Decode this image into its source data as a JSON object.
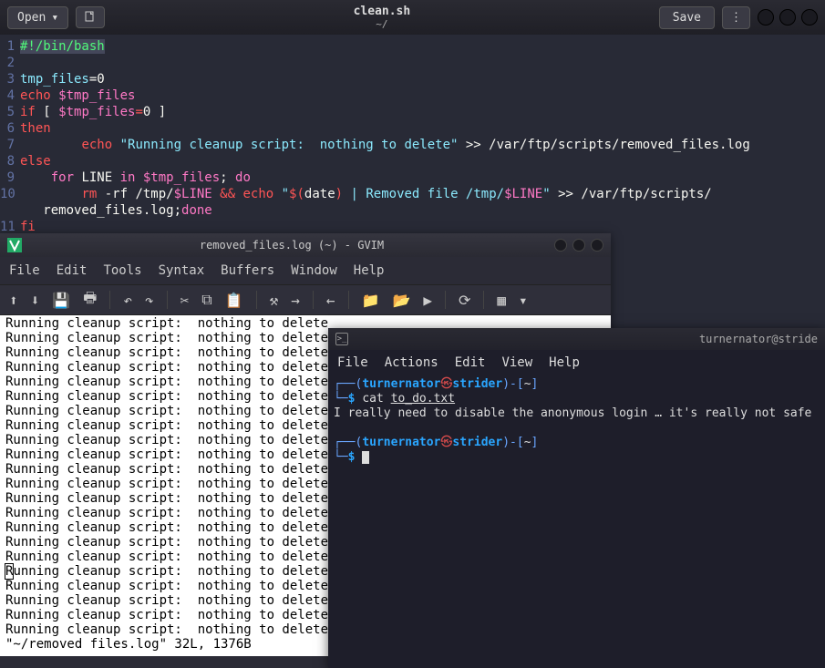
{
  "gedit": {
    "open_label": "Open",
    "title": "clean.sh",
    "subtitle": "~/",
    "save_label": "Save",
    "code": {
      "l1": {
        "a": "#!/bin/bash"
      },
      "l3": {
        "a": "tmp_files",
        "b": "=0"
      },
      "l4": {
        "a": "echo",
        "b": " $tmp_files"
      },
      "l5": {
        "a": "if",
        "b": " [ ",
        "c": "$tmp_files",
        "d": "=",
        "e": "0",
        "f": " ]"
      },
      "l6": {
        "a": "then"
      },
      "l7": {
        "a": "        ",
        "b": "echo",
        "c": " \"Running cleanup script:  nothing to delete\"",
        "d": " >> ",
        "e": "/var/ftp/scripts/removed_files.log"
      },
      "l8": {
        "a": "else"
      },
      "l9": {
        "a": "    ",
        "b": "for",
        "c": " LINE ",
        "d": "in",
        "e": " $tmp_files",
        "f": "; ",
        "g": "do"
      },
      "l10": {
        "a": "        ",
        "b": "rm",
        "c": " -rf /tmp/",
        "d": "$LINE",
        "e": " && ",
        "f": "echo",
        "g": " \"",
        "h": "$(",
        "i": "date",
        "j": ")",
        "k": " | Removed file /tmp/",
        "l": "$LINE",
        "m": "\"",
        "n": " >> ",
        "o": "/var/ftp/scripts/"
      },
      "l10b": {
        "a": "   removed_files.log",
        "b": ";",
        "c": "done"
      },
      "l11": {
        "a": "fi"
      }
    }
  },
  "gvim": {
    "title": "removed_files.log (~) - GVIM",
    "menus": [
      "File",
      "Edit",
      "Tools",
      "Syntax",
      "Buffers",
      "Window",
      "Help"
    ],
    "log_line": "Running cleanup script:  nothing to delete",
    "log_count": 22,
    "status": "\"~/removed files.log\" 32L, 1376B"
  },
  "term": {
    "title": "turnernator@stride",
    "menus": [
      "File",
      "Actions",
      "Edit",
      "View",
      "Help"
    ],
    "user": "turnernator",
    "host": "strider",
    "cwd": "~",
    "cmd1": "cat ",
    "cmd1_file": "to_do.txt",
    "output1": "I really need to disable the anonymous login … it's really not safe"
  }
}
